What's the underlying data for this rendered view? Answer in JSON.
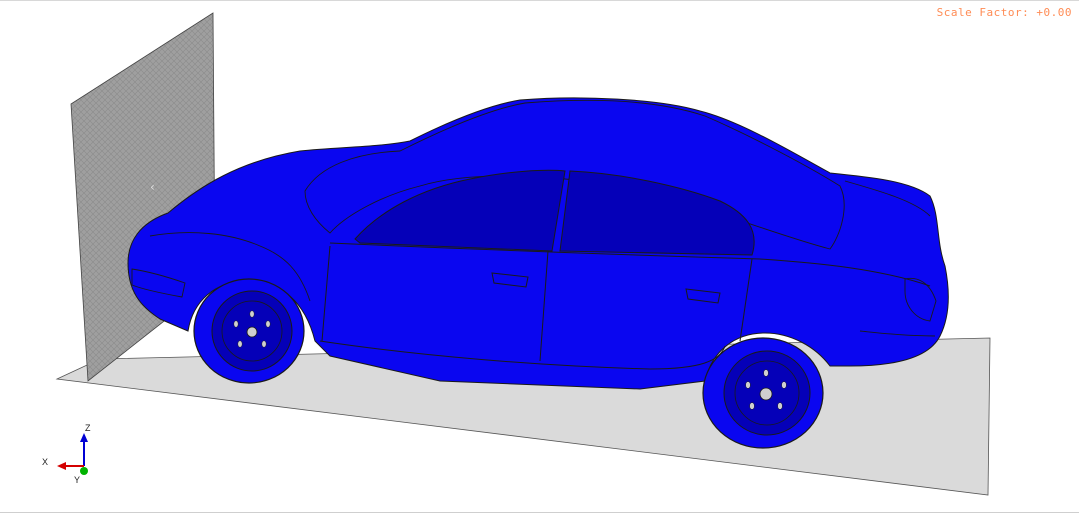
{
  "viewport": {
    "scale_factor_text": "Scale Factor: +0.00",
    "scale_factor_color": "#ff8c55"
  },
  "scene": {
    "vehicle_color": "#0a06f0",
    "vehicle_shade": "#0500b8",
    "barrier_color": "#a9a9a9",
    "ground_color": "#d9d9d9",
    "outline_color": "#1a1a1a"
  },
  "triad": {
    "x_label": "X",
    "y_label": "Y",
    "z_label": "Z",
    "x_color": "#d40000",
    "y_color": "#00b300",
    "z_color": "#0000d4"
  }
}
